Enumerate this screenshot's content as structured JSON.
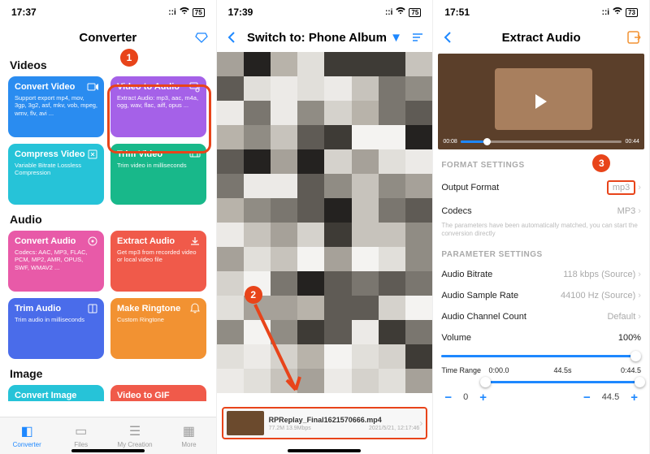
{
  "statusbar": {
    "t1": "17:37",
    "t2": "17:39",
    "t3": "17:51",
    "battery": "75",
    "battery3": "73"
  },
  "panel1": {
    "title": "Converter",
    "section_videos": "Videos",
    "section_audio": "Audio",
    "section_image": "Image",
    "cards": {
      "convert_video": {
        "title": "Convert Video",
        "desc": "Support export mp4, mov, 3gp, 3g2, asf, mkv, vob, mpeg, wmv, flv, avi ..."
      },
      "video_to_audio": {
        "title": "Video to Audio",
        "desc": "Extract Audio: mp3, aac, m4a, ogg, wav, flac, aiff, opus ..."
      },
      "compress_video": {
        "title": "Compress Video",
        "desc": "Variable Bitrate Lossless Compression"
      },
      "trim_video": {
        "title": "Trim Video",
        "desc": "Trim video in milliseconds"
      },
      "convert_audio": {
        "title": "Convert Audio",
        "desc": "Codecs: AAC, MP3, FLAC, PCM, MP2, AMR, OPUS, SWF, WMAV2 ..."
      },
      "extract_audio": {
        "title": "Extract Audio",
        "desc": "Get mp3 from recorded video or local video file"
      },
      "trim_audio": {
        "title": "Trim Audio",
        "desc": "Trim audio in milliseconds"
      },
      "make_ringtone": {
        "title": "Make Ringtone",
        "desc": "Custom Ringtone"
      },
      "convert_image": {
        "title": "Convert Image"
      },
      "video_to_gif": {
        "title": "Video to GIF"
      }
    },
    "tabs": {
      "converter": "Converter",
      "files": "Files",
      "my_creation": "My Creation",
      "more": "More"
    }
  },
  "panel2": {
    "title": "Switch to: Phone Album",
    "file": {
      "name": "RPReplay_Final1621570666.mp4",
      "size": "77.2M 13.9Mbps",
      "date": "2021/5/21, 12:17:46"
    }
  },
  "panel3": {
    "title": "Extract Audio",
    "player": {
      "current": "00:08",
      "total": "00:44"
    },
    "section_format": "FORMAT SETTINGS",
    "section_param": "PARAMETER SETTINGS",
    "rows": {
      "output_format": {
        "label": "Output Format",
        "value": "mp3"
      },
      "codecs": {
        "label": "Codecs",
        "value": "MP3"
      },
      "note": "The parameters have been automatically matched, you can start the conversion directly",
      "bitrate": {
        "label": "Audio Bitrate",
        "value": "118 kbps (Source)"
      },
      "sample_rate": {
        "label": "Audio Sample Rate",
        "value": "44100 Hz (Source)"
      },
      "channel": {
        "label": "Audio Channel Count",
        "value": "Default"
      },
      "volume": {
        "label": "Volume",
        "value": "100%"
      },
      "time_range": {
        "label": "Time Range",
        "start": "0:00.0",
        "dur": "44.5s",
        "end": "0:44.5"
      }
    },
    "spin": {
      "left": "0",
      "right": "44.5"
    }
  },
  "badges": {
    "b1": "1",
    "b2": "2",
    "b3": "3"
  }
}
